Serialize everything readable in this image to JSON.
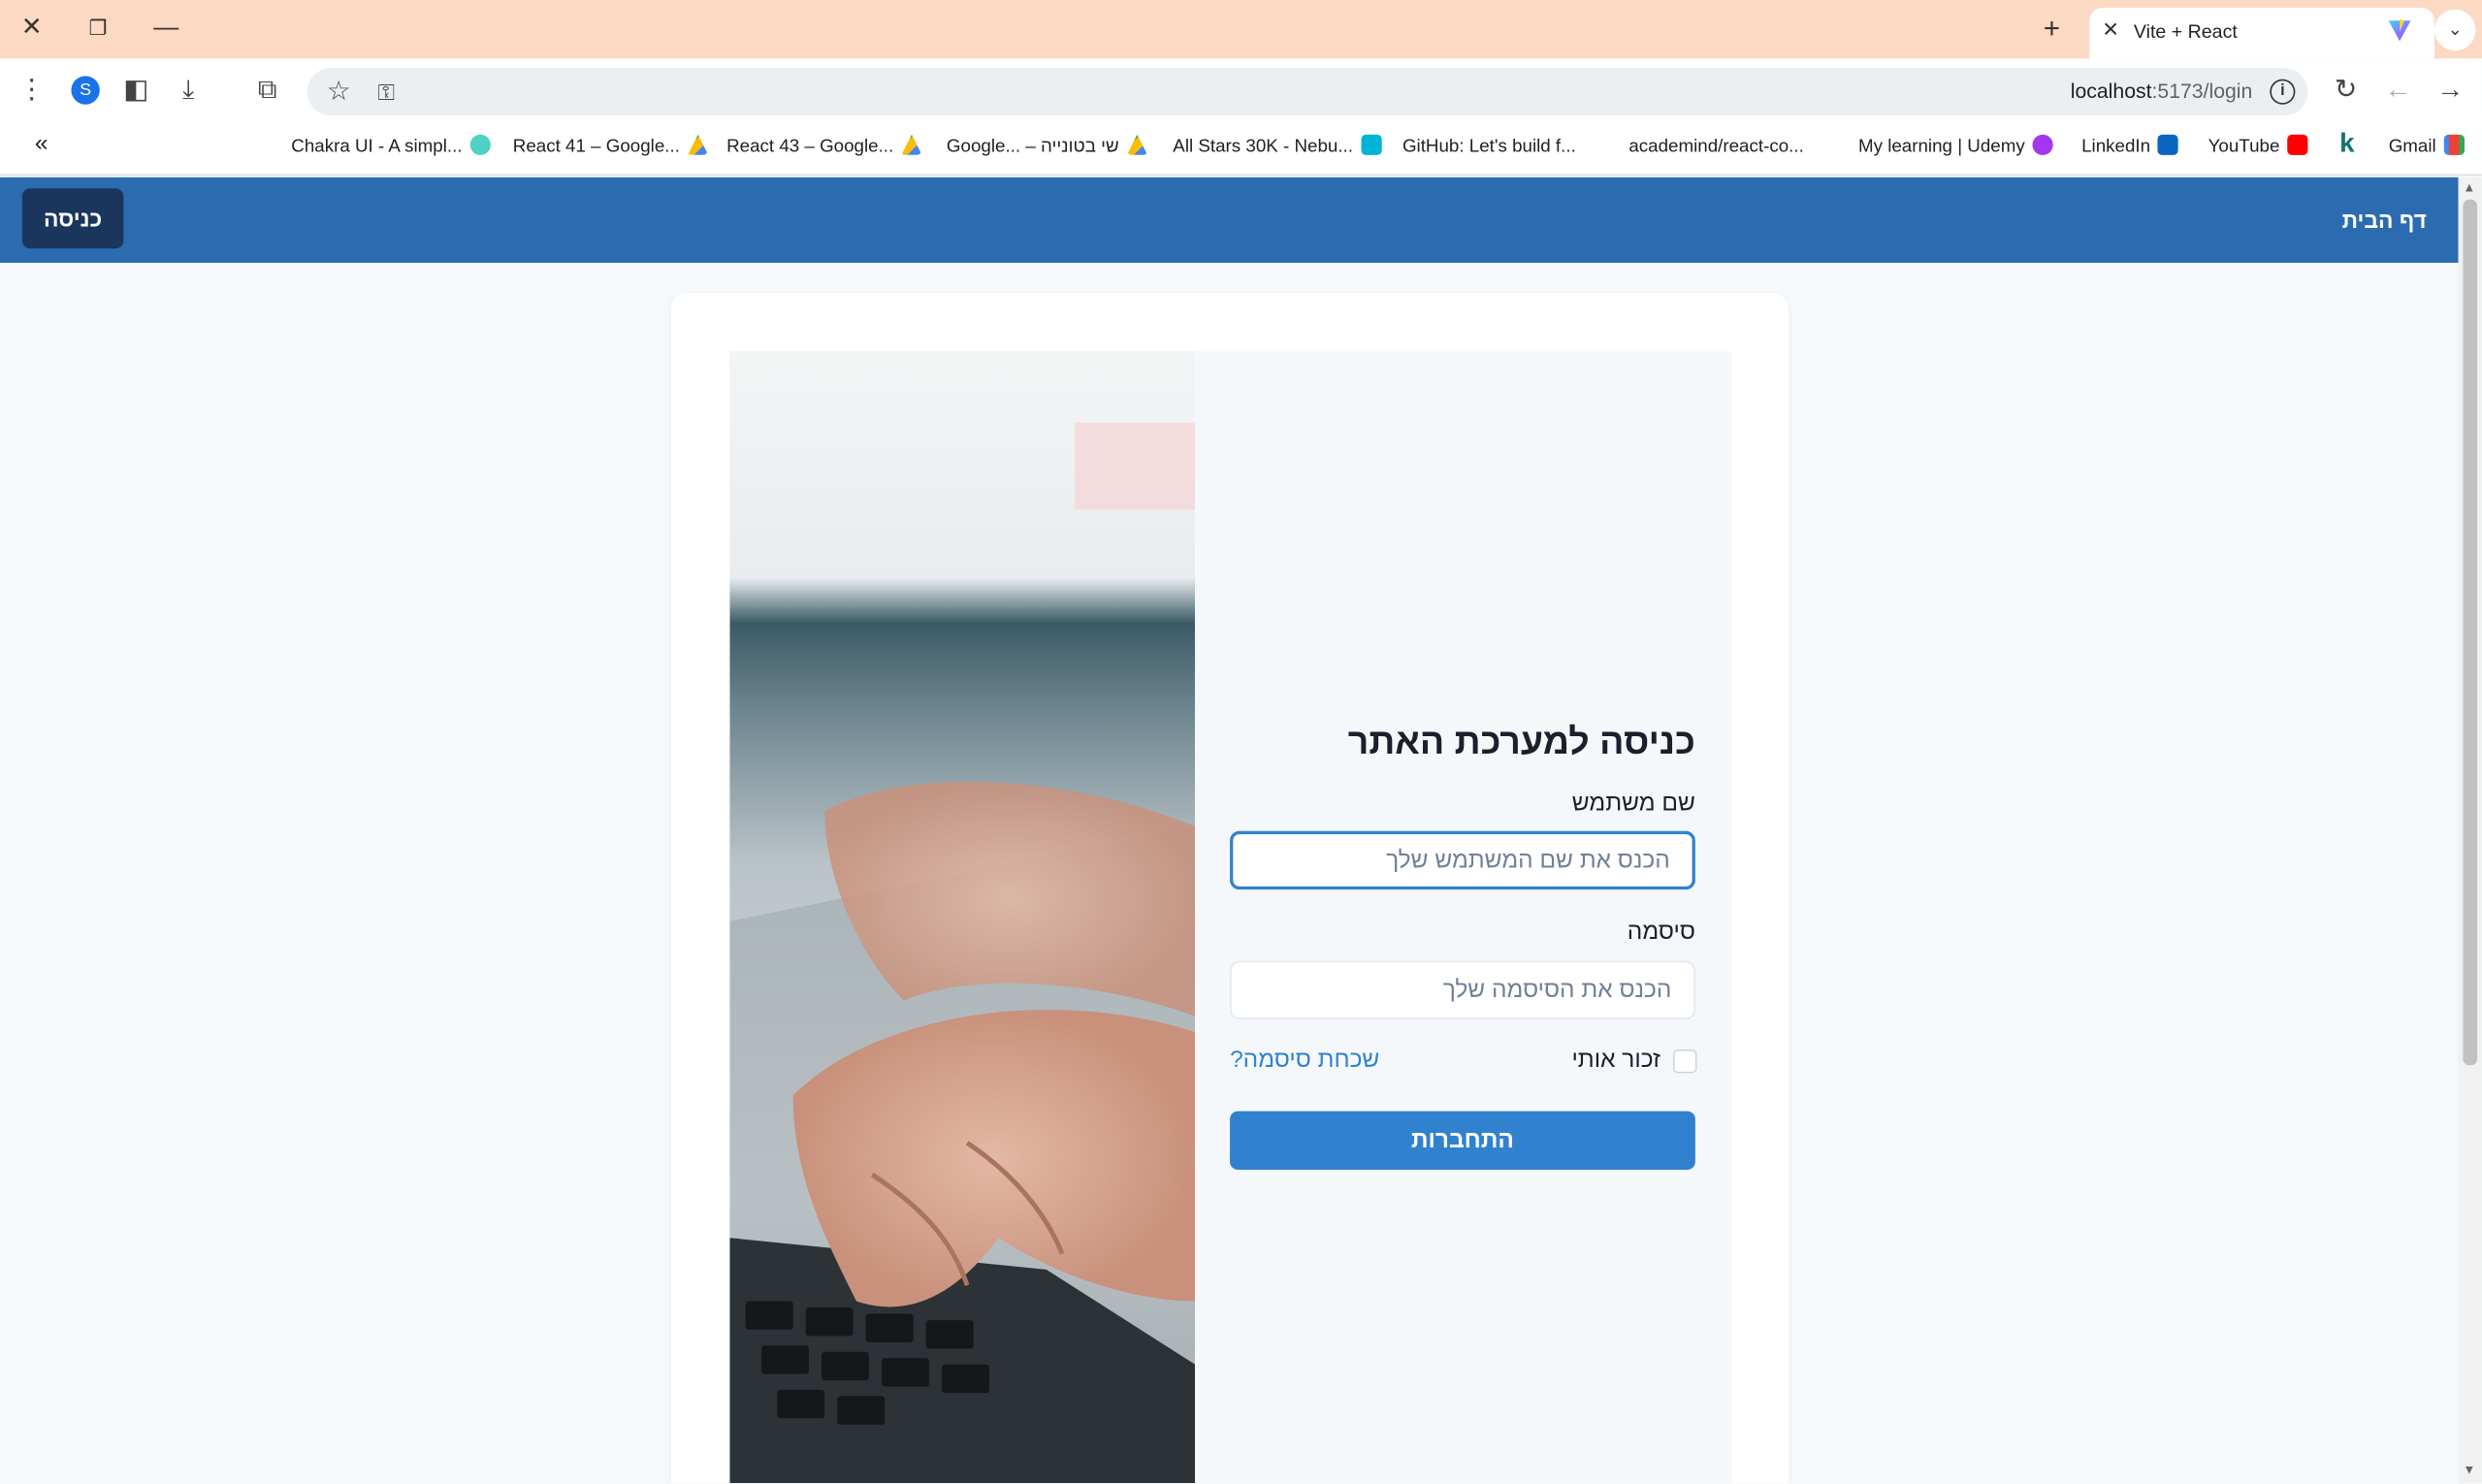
{
  "browser": {
    "tab_title": "Vite + React",
    "url_host": "localhost",
    "url_path": ":5173/login",
    "profile_initial": "S",
    "bookmarks": [
      {
        "label": "Chakra UI - A simpl...",
        "icon": "chakra-icon",
        "color": "#4fd1c5"
      },
      {
        "label": "React 41 – Google...",
        "icon": "google-drive-icon",
        "color": "#fbbc04"
      },
      {
        "label": "React 43  – Google...",
        "icon": "google-drive-icon",
        "color": "#fbbc04"
      },
      {
        "label": "Google... – שי בטונייה",
        "icon": "google-drive-icon",
        "color": "#fbbc04"
      },
      {
        "label": "All Stars 30K - Nebu...",
        "icon": "nebula-icon",
        "color": "#00b4d8"
      },
      {
        "label": "GitHub: Let's build f...",
        "icon": "github-icon",
        "color": "#ffffff"
      },
      {
        "label": "academind/react-co...",
        "icon": "blank-icon",
        "color": "#ffffff"
      },
      {
        "label": "My learning | Udemy",
        "icon": "udemy-icon",
        "color": "#a435f0"
      },
      {
        "label": "LinkedIn",
        "icon": "linkedin-icon",
        "color": "#0a66c2"
      },
      {
        "label": "YouTube",
        "icon": "youtube-icon",
        "color": "#ff0000"
      },
      {
        "label": "k",
        "icon": "k-icon",
        "color": "#0f766e"
      },
      {
        "label": "Gmail",
        "icon": "gmail-icon",
        "color": "#ea4335"
      }
    ]
  },
  "navbar": {
    "home_label": "דף הבית",
    "login_label": "כניסה",
    "color": "#2b6cb0"
  },
  "form": {
    "title": "כניסה למערכת האתר",
    "username_label": "שם משתמש",
    "username_placeholder": "הכנס את שם המשתמש שלך",
    "password_label": "סיסמה",
    "password_placeholder": "הכנס את הסיסמה שלך",
    "remember_label": "זכור אותי",
    "forgot_label": "שכחת סיסמה?",
    "submit_label": "התחברות",
    "accent": "#3182ce"
  }
}
